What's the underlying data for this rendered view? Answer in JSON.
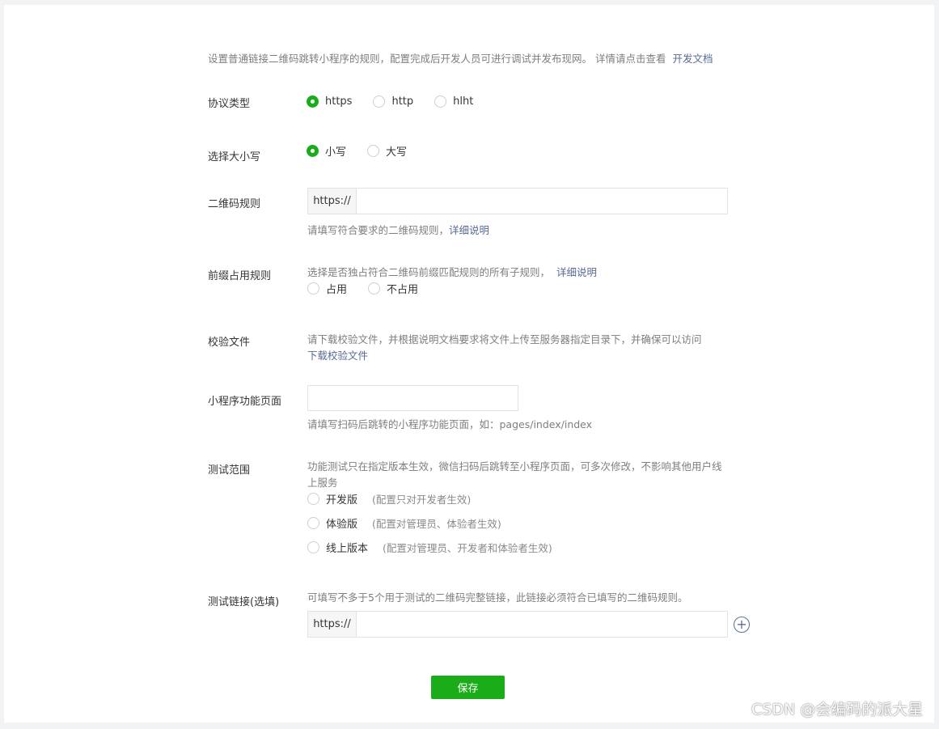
{
  "intro": {
    "text": "设置普通链接二维码跳转小程序的规则，配置完成后开发人员可进行调试并发布现网。 详情请点击查看",
    "link": "开发文档"
  },
  "protocol": {
    "label": "协议类型",
    "options": [
      "https",
      "http",
      "hlht"
    ],
    "selected": "https"
  },
  "case": {
    "label": "选择大小写",
    "options": [
      "小写",
      "大写"
    ],
    "selected": "小写"
  },
  "qr_rule": {
    "label": "二维码规则",
    "prefix": "https://",
    "value": "",
    "hint": "请填写符合要求的二维码规则，",
    "hint_link": "详细说明"
  },
  "prefix_rule": {
    "label": "前缀占用规则",
    "desc": "选择是否独占符合二维码前缀匹配规则的所有子规则，",
    "desc_link": "详细说明",
    "options": [
      "占用",
      "不占用"
    ]
  },
  "verify_file": {
    "label": "校验文件",
    "desc": "请下载校验文件，并根据说明文档要求将文件上传至服务器指定目录下，并确保可以访问",
    "download_link": "下载校验文件"
  },
  "page": {
    "label": "小程序功能页面",
    "value": "",
    "hint": "请填写扫码后跳转的小程序功能页面，如：pages/index/index"
  },
  "test_scope": {
    "label": "测试范围",
    "desc_line1": "功能测试只在指定版本生效，微信扫码后跳转至小程序页面，可多次修改，不影响其他用户线",
    "desc_line2": "上服务",
    "options": [
      {
        "label": "开发版",
        "note": "(配置只对开发者生效)"
      },
      {
        "label": "体验版",
        "note": "(配置对管理员、体验者生效)"
      },
      {
        "label": "线上版本",
        "note": "(配置对管理员、开发者和体验者生效)"
      }
    ]
  },
  "test_link": {
    "label": "测试链接(选填)",
    "desc": "可填写不多于5个用于测试的二维码完整链接，此链接必须符合已填写的二维码规则。",
    "prefix": "https://",
    "value": ""
  },
  "save_label": "保存",
  "watermark": "CSDN @会编码的派大星",
  "colors": {
    "accent_green": "#1aad19",
    "link_blue": "#576b95"
  }
}
